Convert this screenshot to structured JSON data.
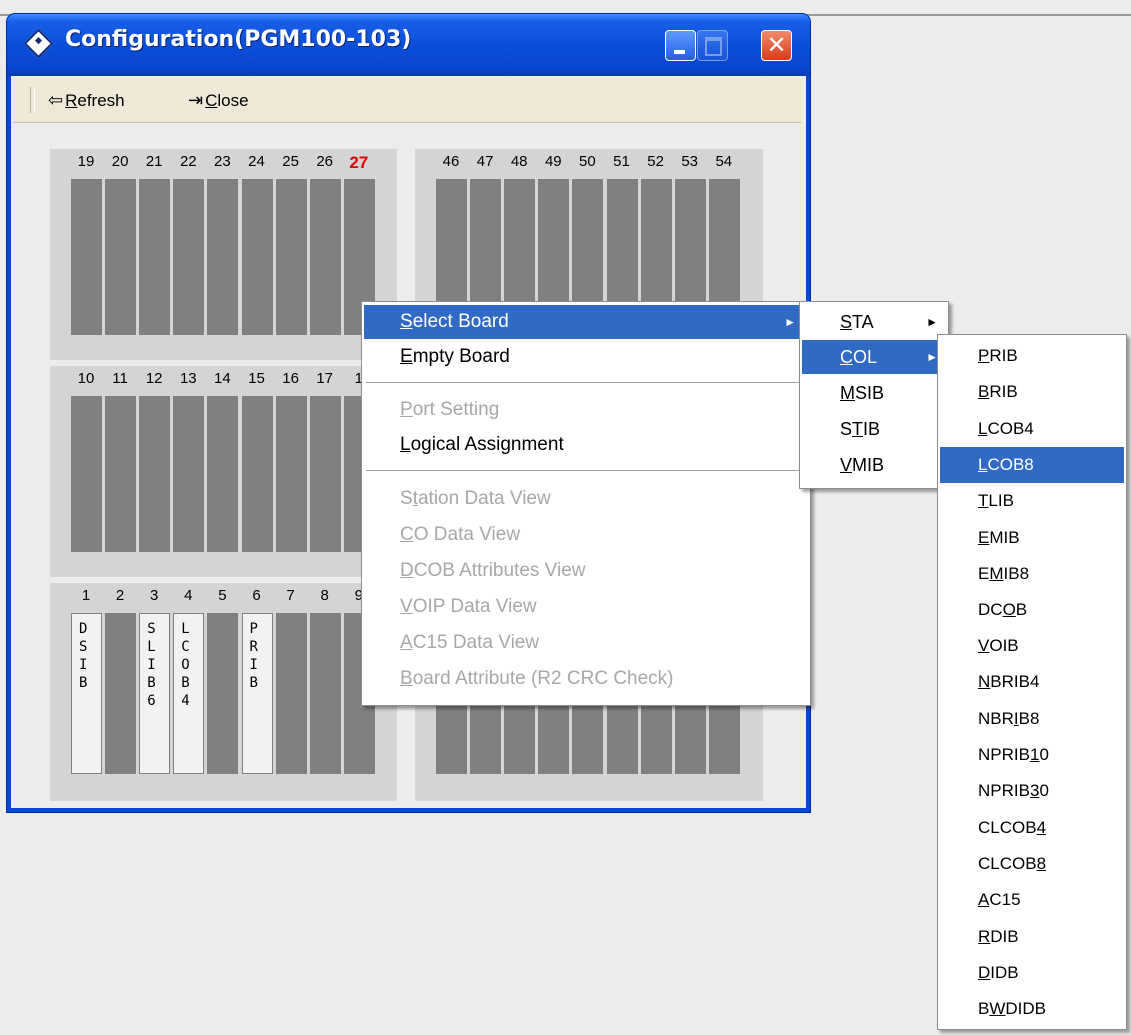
{
  "window": {
    "title": "Configuration(PGM100-103)",
    "close_glyph": "✕"
  },
  "toolbar": {
    "refresh": {
      "prefix": "",
      "accel": "R",
      "rest": "efresh",
      "icon": "back-arrow-icon"
    },
    "close": {
      "prefix": "",
      "accel": "C",
      "rest": "lose",
      "icon": "exit-door-icon"
    }
  },
  "cabinets": {
    "top_left": {
      "slots": [
        "19",
        "20",
        "21",
        "22",
        "23",
        "24",
        "25",
        "26",
        "27"
      ],
      "active_slot": "27"
    },
    "top_right": {
      "slots": [
        "46",
        "47",
        "48",
        "49",
        "50",
        "51",
        "52",
        "53",
        "54"
      ]
    },
    "mid_left": {
      "slots": [
        "10",
        "11",
        "12",
        "13",
        "14",
        "15",
        "16",
        "17",
        "1"
      ]
    },
    "bottom_left": {
      "slots": [
        "1",
        "2",
        "3",
        "4",
        "5",
        "6",
        "7",
        "8",
        "9"
      ],
      "boards": [
        "DSIB",
        "",
        "SLIB6",
        "LCOB4",
        "",
        "PRIB",
        "",
        "",
        ""
      ]
    }
  },
  "context_menu": {
    "items": [
      {
        "pre": "",
        "accel": "S",
        "rest": "elect Board",
        "state": "selected",
        "submenu": true
      },
      {
        "pre": "",
        "accel": "E",
        "rest": "mpty Board",
        "state": "normal"
      },
      {
        "pre": "",
        "accel": "P",
        "rest": "ort Setting",
        "state": "disabled"
      },
      {
        "pre": "",
        "accel": "L",
        "rest": "ogical Assignment",
        "state": "normal"
      },
      {
        "pre": "S",
        "accel": "t",
        "rest": "ation Data View",
        "state": "disabled"
      },
      {
        "pre": "",
        "accel": "C",
        "rest": "O Data View",
        "state": "disabled"
      },
      {
        "pre": "",
        "accel": "D",
        "rest": "COB Attributes View",
        "state": "disabled"
      },
      {
        "pre": "",
        "accel": "V",
        "rest": "OIP Data View",
        "state": "disabled"
      },
      {
        "pre": "",
        "accel": "A",
        "rest": "C15 Data View",
        "state": "disabled"
      },
      {
        "pre": "",
        "accel": "B",
        "rest": "oard Attribute (R2 CRC Check)",
        "state": "disabled"
      }
    ],
    "submenu_arrow": "►"
  },
  "board_type_menu": {
    "items": [
      {
        "pre": "",
        "accel": "S",
        "rest": "TA",
        "state": "normal",
        "submenu": true
      },
      {
        "pre": "",
        "accel": "C",
        "rest": "OL",
        "state": "selected",
        "submenu": true
      },
      {
        "pre": "",
        "accel": "M",
        "rest": "SIB",
        "state": "normal"
      },
      {
        "pre": "S",
        "accel": "T",
        "rest": "IB",
        "state": "normal"
      },
      {
        "pre": "",
        "accel": "V",
        "rest": "MIB",
        "state": "normal"
      }
    ]
  },
  "col_menu": {
    "items": [
      {
        "pre": "",
        "accel": "P",
        "rest": "RIB",
        "state": "normal"
      },
      {
        "pre": "",
        "accel": "B",
        "rest": "RIB",
        "state": "normal"
      },
      {
        "pre": "",
        "accel": "L",
        "rest": "COB4",
        "state": "normal"
      },
      {
        "pre": "",
        "accel": "L",
        "rest": "COB8",
        "state": "selected"
      },
      {
        "pre": "",
        "accel": "T",
        "rest": "LIB",
        "state": "normal"
      },
      {
        "pre": "",
        "accel": "E",
        "rest": "MIB",
        "state": "normal"
      },
      {
        "pre": "E",
        "accel": "M",
        "rest": "IB8",
        "state": "normal"
      },
      {
        "pre": "DC",
        "accel": "O",
        "rest": "B",
        "state": "normal"
      },
      {
        "pre": "",
        "accel": "V",
        "rest": "OIB",
        "state": "normal"
      },
      {
        "pre": "",
        "accel": "N",
        "rest": "BRIB4",
        "state": "normal"
      },
      {
        "pre": "NBR",
        "accel": "I",
        "rest": "B8",
        "state": "normal"
      },
      {
        "pre": "NPRIB",
        "accel": "1",
        "rest": "0",
        "state": "normal"
      },
      {
        "pre": "NPRIB",
        "accel": "3",
        "rest": "0",
        "state": "normal"
      },
      {
        "pre": "CLCOB",
        "accel": "4",
        "rest": "",
        "state": "normal"
      },
      {
        "pre": "CLCOB",
        "accel": "8",
        "rest": "",
        "state": "normal"
      },
      {
        "pre": "",
        "accel": "A",
        "rest": "C15",
        "state": "normal"
      },
      {
        "pre": "",
        "accel": "R",
        "rest": "DIB",
        "state": "normal"
      },
      {
        "pre": "",
        "accel": "D",
        "rest": "IDB",
        "state": "normal"
      },
      {
        "pre": "B",
        "accel": "W",
        "rest": "DIDB",
        "state": "normal"
      }
    ]
  }
}
